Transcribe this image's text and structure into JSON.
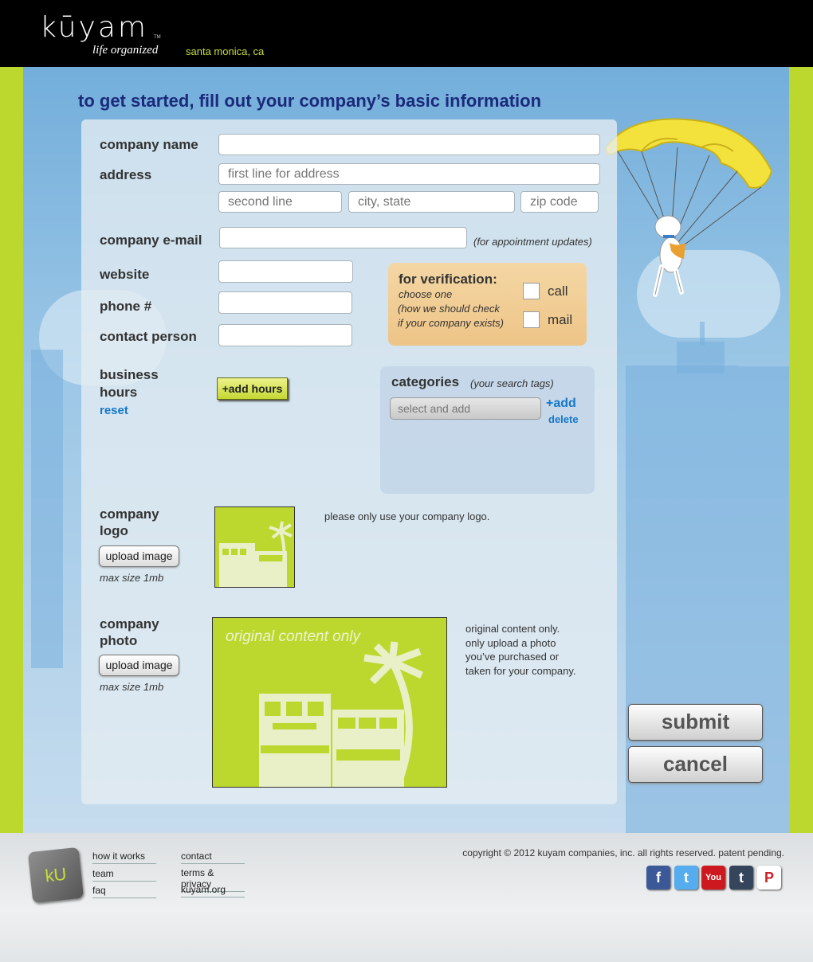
{
  "header": {
    "logo_text": "kūyam",
    "trademark": "TM",
    "tagline": "life organized",
    "location": "santa monica, ca"
  },
  "headline": "to get started, fill out your company’s basic information",
  "form": {
    "company_name_label": "company name",
    "company_name_value": "",
    "address_label": "address",
    "address_line1_placeholder": "first line for address",
    "address_line2_placeholder": "second line",
    "city_state_placeholder": "city, state",
    "zip_placeholder": "zip code",
    "email_label": "company e-mail",
    "email_value": "",
    "email_note": "(for appointment updates)",
    "website_label": "website",
    "phone_label": "phone #",
    "contact_label": "contact person",
    "hours_label_1": "business",
    "hours_label_2": "hours",
    "reset_label": "reset",
    "add_hours_label": "+add hours",
    "logo_label_1": "company",
    "logo_label_2": "logo",
    "upload_image_label": "upload image",
    "max_size": "max size 1mb",
    "logo_note": "please only use your company logo.",
    "photo_label_1": "company",
    "photo_label_2": "photo",
    "photo_overlay": "original content only",
    "photo_note": [
      "original content only.",
      "only upload a photo",
      "you’ve purchased or",
      "taken for your company."
    ]
  },
  "verification": {
    "title": "for verification:",
    "choose": "choose one",
    "hint_1": "(how we should check",
    "hint_2": "if your company exists)",
    "option_call": "call",
    "option_mail": "mail",
    "call_checked": false,
    "mail_checked": false
  },
  "categories": {
    "title": "categories",
    "subtitle": "(your search tags)",
    "select_placeholder": "select and add",
    "add_label": "+add",
    "delete_label": "delete"
  },
  "actions": {
    "submit": "submit",
    "cancel": "cancel"
  },
  "footer": {
    "logo_mark": "kU",
    "links_col1": [
      "how it works",
      "team",
      "faq"
    ],
    "links_col2": [
      "contact",
      "terms & privacy",
      "kuyam.org"
    ],
    "copyright": "copyright © 2012 kuyam companies, inc. all rights reserved. patent pending.",
    "social": [
      {
        "name": "facebook-icon",
        "glyph": "f",
        "color": "#3b5998"
      },
      {
        "name": "twitter-icon",
        "glyph": "t",
        "color": "#55acee"
      },
      {
        "name": "youtube-icon",
        "glyph": "You",
        "color": "#cc181e"
      },
      {
        "name": "tumblr-icon",
        "glyph": "t",
        "color": "#35465c"
      },
      {
        "name": "pinterest-icon",
        "glyph": "P",
        "color": "#cb2027"
      }
    ]
  },
  "colors": {
    "brand_green": "#bcd82f",
    "headline_navy": "#1b2a7a",
    "link_blue": "#1478c8"
  }
}
